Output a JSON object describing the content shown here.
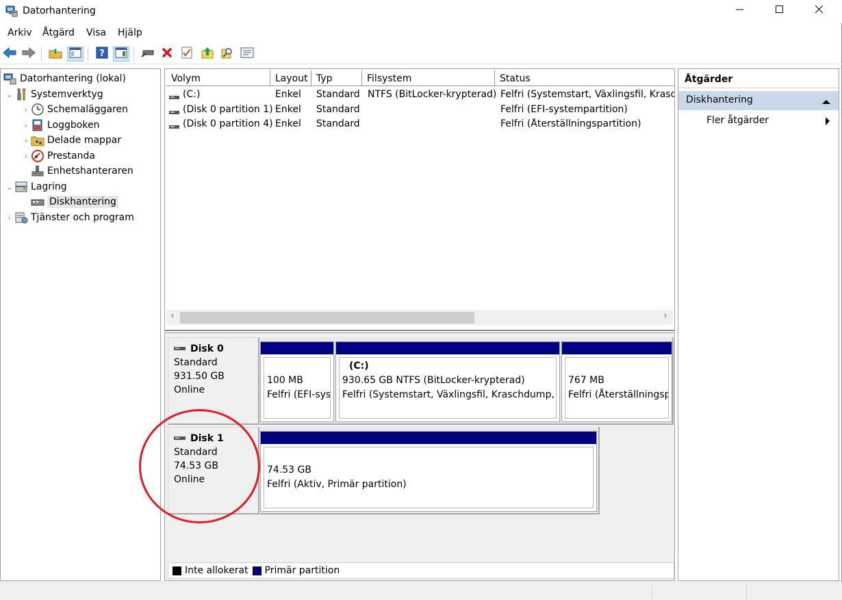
{
  "window": {
    "title": "Datorhantering",
    "minimize_icon": "minimize-icon",
    "maximize_icon": "maximize-icon",
    "close_icon": "close-icon"
  },
  "menu": [
    "Arkiv",
    "Åtgärd",
    "Visa",
    "Hjälp"
  ],
  "toolbar": [
    "back-arrow-icon",
    "forward-arrow-icon",
    "folder-up-icon",
    "show-hide-tree-icon",
    "help-icon",
    "show-hide-action-pane-icon",
    "connect-drive-icon",
    "delete-icon",
    "properties-icon",
    "import-icon",
    "search-icon",
    "list-view-icon"
  ],
  "tree": {
    "root": "Datorhantering (lokal)",
    "systemverktyg": "Systemverktyg",
    "schemalaggaren": "Schemaläggaren",
    "loggboken": "Loggboken",
    "delade_mappar": "Delade mappar",
    "prestanda": "Prestanda",
    "enhetshanteraren": "Enhetshanteraren",
    "lagring": "Lagring",
    "diskhantering": "Diskhantering",
    "tjanster": "Tjänster och program"
  },
  "volumes": {
    "columns": [
      "Volym",
      "Layout",
      "Typ",
      "Filsystem",
      "Status"
    ],
    "rows": [
      {
        "volym": "(C:)",
        "layout": "Enkel",
        "typ": "Standard",
        "filsystem": "NTFS (BitLocker-krypterad)",
        "status": "Felfri (Systemstart, Växlingsfil, Kraschd"
      },
      {
        "volym": "(Disk 0 partition 1)",
        "layout": "Enkel",
        "typ": "Standard",
        "filsystem": "",
        "status": "Felfri (EFI-systempartition)"
      },
      {
        "volym": "(Disk 0 partition 4)",
        "layout": "Enkel",
        "typ": "Standard",
        "filsystem": "",
        "status": "Felfri (Återställningspartition)"
      }
    ]
  },
  "disks": [
    {
      "name": "Disk 0",
      "type": "Standard",
      "size": "931.50 GB",
      "state": "Online",
      "partitions": [
        {
          "label": "",
          "size": "100 MB",
          "status": "Felfri (EFI-syst"
        },
        {
          "label": "(C:)",
          "size": "930.65 GB NTFS (BitLocker-krypterad)",
          "status": "Felfri (Systemstart, Växlingsfil, Kraschdump, Sta"
        },
        {
          "label": "",
          "size": "767 MB",
          "status": "Felfri (Återställningsp"
        }
      ]
    },
    {
      "name": "Disk 1",
      "type": "Standard",
      "size": "74.53 GB",
      "state": "Online",
      "partitions": [
        {
          "label": "",
          "size": "74.53 GB",
          "status": "Felfri (Aktiv, Primär partition)"
        }
      ]
    }
  ],
  "legend": [
    {
      "label": "Inte allokerat",
      "color": "#000000"
    },
    {
      "label": "Primär partition",
      "color": "#000080"
    }
  ],
  "actions": {
    "header": "Åtgärder",
    "section": "Diskhantering",
    "item": "Fler åtgärder"
  },
  "colors": {
    "primary_partition": "#000080",
    "annotation": "#e01b22",
    "selected_section": "#c8d9ea"
  }
}
